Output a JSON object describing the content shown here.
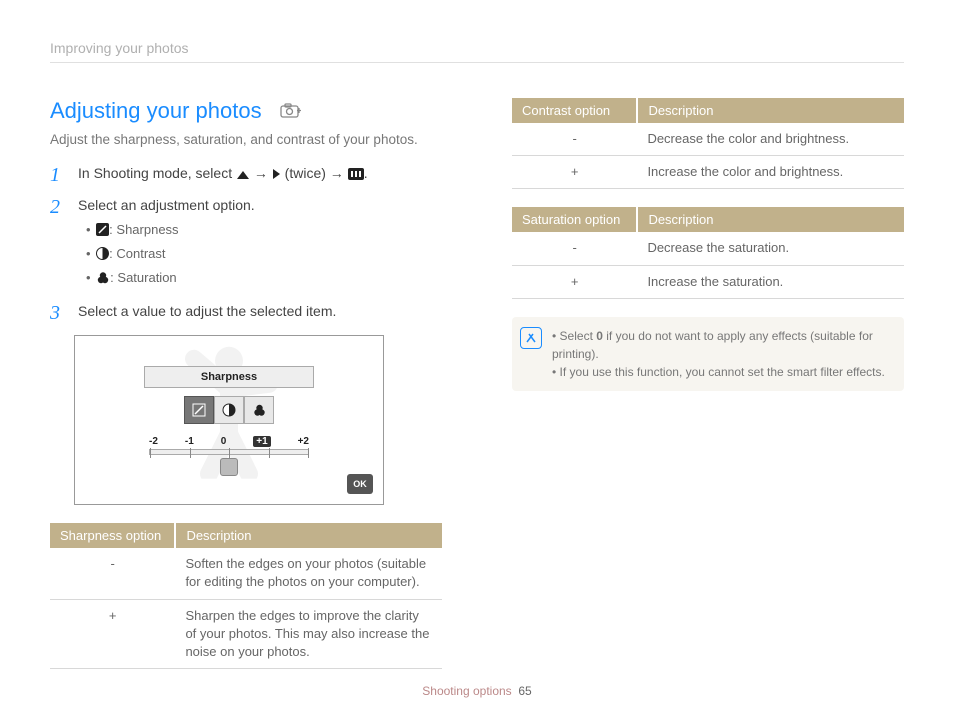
{
  "header": "Improving your photos",
  "title": "Adjusting your photos",
  "intro": "Adjust the sharpness, saturation, and contrast of your photos.",
  "steps": {
    "s1_prefix": "In Shooting mode, select ",
    "s1_twice": " (twice) ",
    "s2": "Select an adjustment option.",
    "s2_items": {
      "sharpness": ": Sharpness",
      "contrast": ": Contrast",
      "saturation": ": Saturation"
    },
    "s3": "Select a value to adjust the selected item."
  },
  "diagram": {
    "label": "Sharpness",
    "ticks": [
      "-2",
      "-1",
      "0",
      "+1",
      "+2"
    ],
    "active_tick": "+1",
    "ok": "OK"
  },
  "tables": {
    "sharpness": {
      "h1": "Sharpness option",
      "h2": "Description",
      "rows": [
        {
          "opt": "-",
          "desc": "Soften the edges on your photos (suitable for editing the photos on your computer)."
        },
        {
          "opt": "+",
          "desc": "Sharpen the edges to improve the clarity of your photos. This may also increase the noise on your photos."
        }
      ]
    },
    "contrast": {
      "h1": "Contrast option",
      "h2": "Description",
      "rows": [
        {
          "opt": "-",
          "desc": "Decrease the color and brightness."
        },
        {
          "opt": "+",
          "desc": "Increase the color and brightness."
        }
      ]
    },
    "saturation": {
      "h1": "Saturation option",
      "h2": "Description",
      "rows": [
        {
          "opt": "-",
          "desc": "Decrease the saturation."
        },
        {
          "opt": "+",
          "desc": "Increase the saturation."
        }
      ]
    }
  },
  "note": {
    "l1_a": "Select ",
    "l1_bold": "0",
    "l1_b": " if you do not want to apply any effects (suitable for printing).",
    "l2": "If you use this function, you cannot set the smart filter effects."
  },
  "footer": {
    "section": "Shooting options",
    "page": "65"
  }
}
